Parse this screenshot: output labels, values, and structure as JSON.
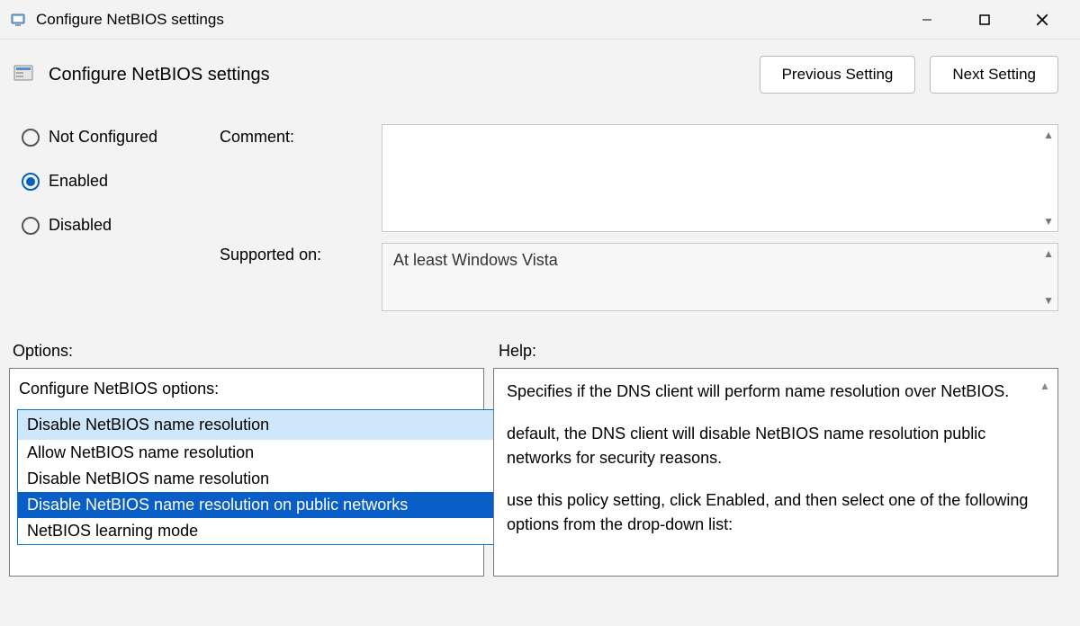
{
  "titlebar": {
    "title": "Configure NetBIOS settings"
  },
  "header": {
    "title": "Configure NetBIOS settings",
    "prev_button": "Previous Setting",
    "next_button": "Next Setting"
  },
  "state_radios": {
    "not_configured": "Not Configured",
    "enabled": "Enabled",
    "disabled": "Disabled",
    "selected": "enabled"
  },
  "labels": {
    "comment": "Comment:",
    "supported_on": "Supported on:",
    "options": "Options:",
    "help": "Help:"
  },
  "supported_on_value": "At least Windows Vista",
  "options_panel": {
    "label": "Configure NetBIOS options:",
    "current": "Disable NetBIOS name resolution",
    "items": [
      "Allow NetBIOS name resolution",
      "Disable NetBIOS name resolution",
      "Disable NetBIOS name resolution on public networks",
      "NetBIOS learning mode"
    ],
    "highlighted_index": 2
  },
  "help_text": {
    "p1": "Specifies if the DNS client will perform name resolution over NetBIOS.",
    "p2": "default, the DNS client will disable NetBIOS name resolution public networks for security reasons.",
    "p3": "use this policy setting, click Enabled, and then select one of the following options from the drop-down list:"
  }
}
